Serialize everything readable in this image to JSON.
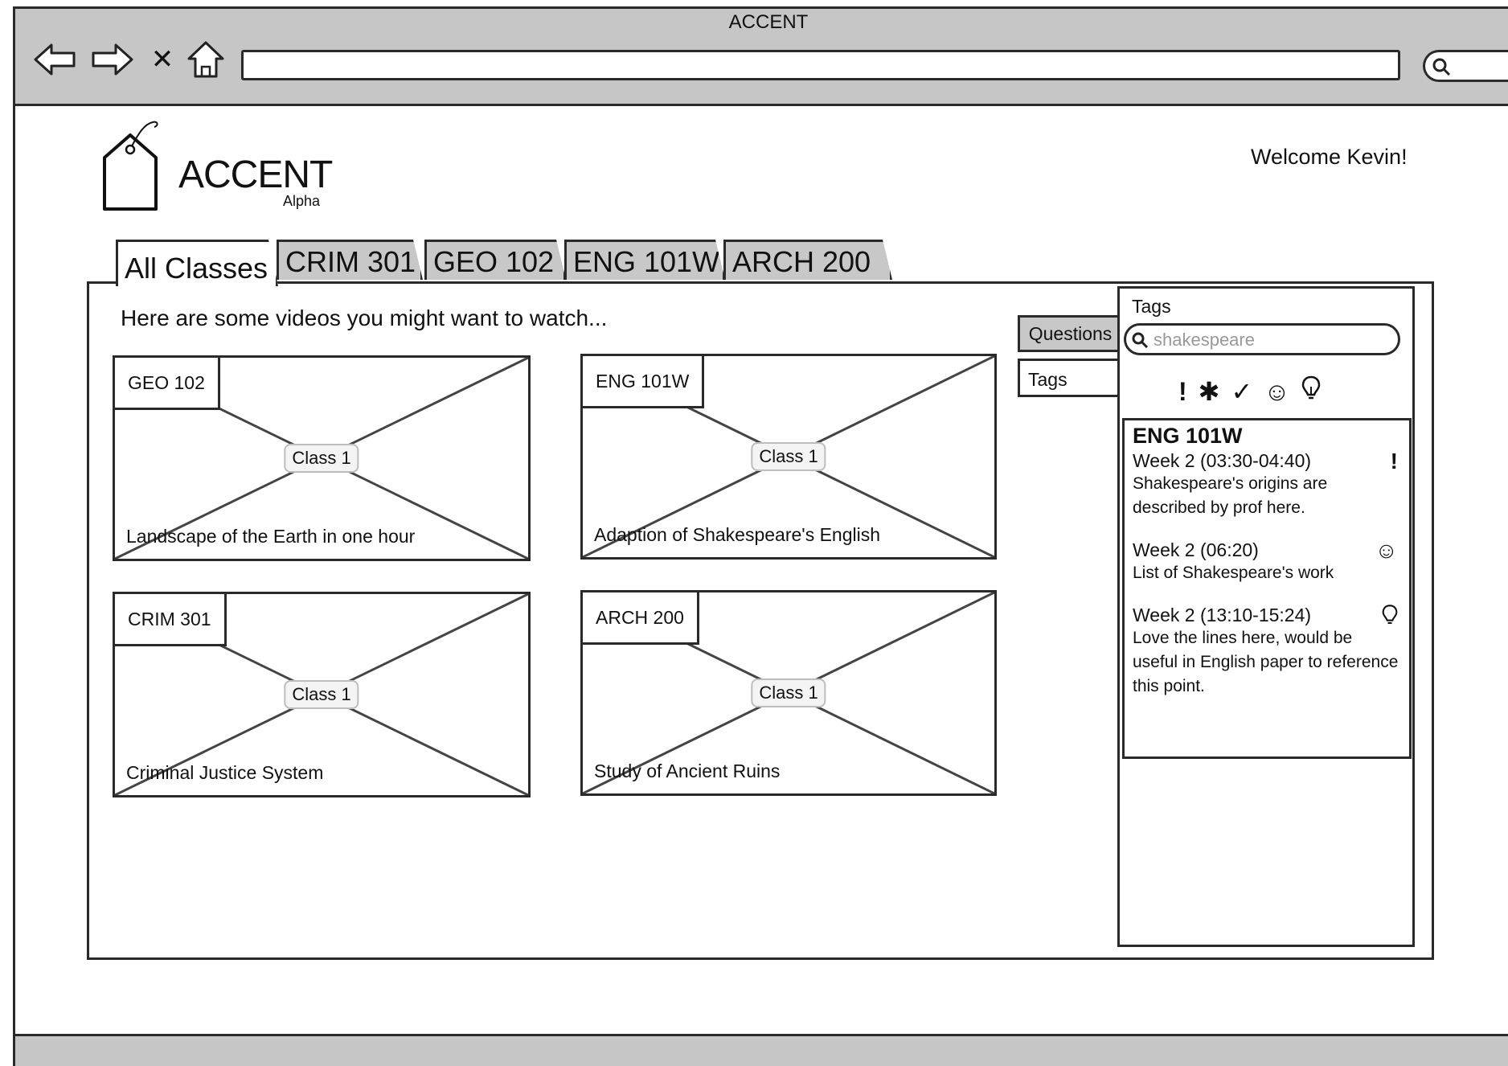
{
  "window": {
    "title": "ACCENT"
  },
  "browser": {
    "nav_icons": [
      "back-arrow-icon",
      "forward-arrow-icon",
      "close-icon",
      "home-icon"
    ],
    "address_value": "",
    "search_value": ""
  },
  "header": {
    "brand": "ACCENT",
    "brand_sub": "Alpha",
    "welcome": "Welcome Kevin!"
  },
  "tabs": [
    {
      "label": "All Classes",
      "active": true
    },
    {
      "label": "CRIM 301",
      "active": false
    },
    {
      "label": "GEO 102",
      "active": false
    },
    {
      "label": "ENG 101W",
      "active": false
    },
    {
      "label": "ARCH 200",
      "active": false
    }
  ],
  "main": {
    "intro": "Here are some videos you might want to watch...",
    "videos": [
      {
        "course": "GEO 102",
        "class": "Class 1",
        "title": "Landscape of the Earth in one hour"
      },
      {
        "course": "ENG 101W",
        "class": "Class 1",
        "title": "Adaption of Shakespeare's English"
      },
      {
        "course": "CRIM 301",
        "class": "Class 1",
        "title": "Criminal Justice System"
      },
      {
        "course": "ARCH 200",
        "class": "Class 1",
        "title": "Study of Ancient Ruins"
      }
    ]
  },
  "side_tabs": {
    "questions": "Questions",
    "tags": "Tags"
  },
  "tags_panel": {
    "title": "Tags",
    "search_value": "shakespeare",
    "icons": [
      "!",
      "✱",
      "✓",
      "☺",
      "💡"
    ],
    "icon_names": [
      "exclamation-icon",
      "asterisk-icon",
      "check-icon",
      "smiley-icon",
      "lightbulb-icon"
    ],
    "course": "ENG 101W",
    "entries": [
      {
        "when": "Week 2 (03:30-04:40)",
        "icon": "!",
        "note": "Shakespeare's origins are described by prof here."
      },
      {
        "when": "Week 2 (06:20)",
        "icon": "☺",
        "note": "List of Shakespeare's work"
      },
      {
        "when": "Week 2 (13:10-15:24)",
        "icon": "💡",
        "note": "Love the lines here, would be useful in English paper to reference this point."
      }
    ]
  }
}
